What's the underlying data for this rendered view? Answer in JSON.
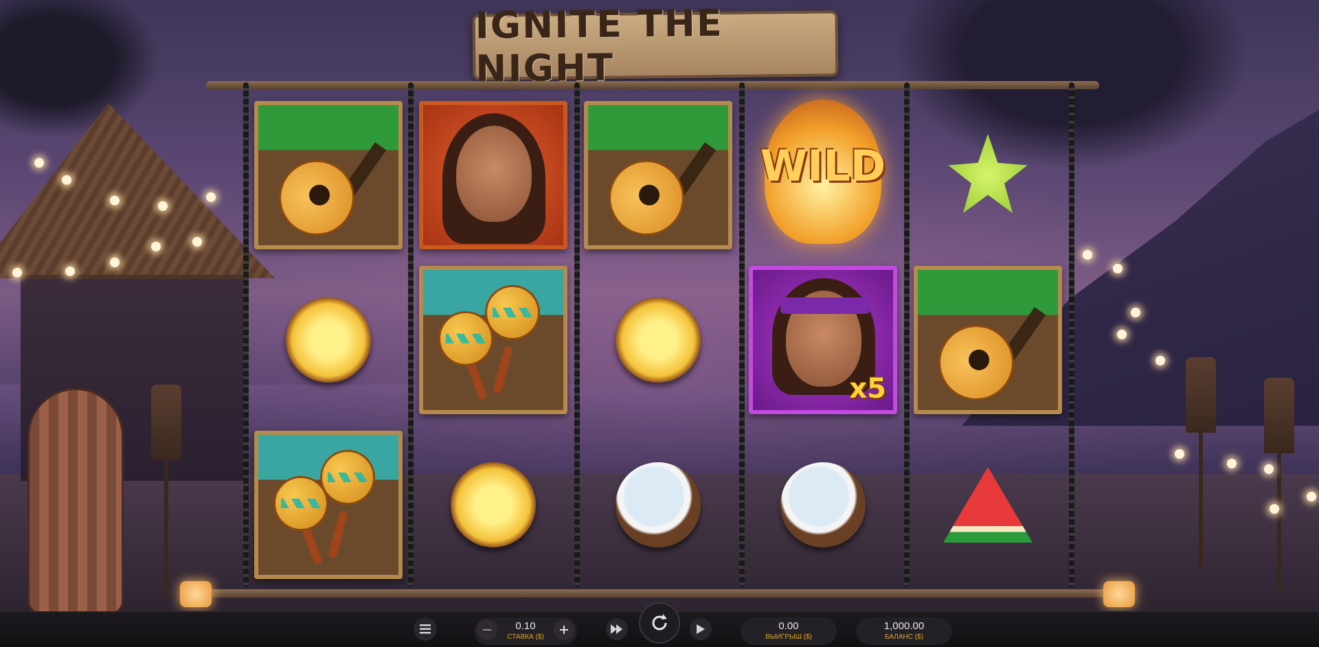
{
  "game": {
    "title": "IGNITE THE NIGHT"
  },
  "reels": [
    [
      "guitar",
      "pineapple",
      "maracas"
    ],
    [
      "woman",
      "maracas",
      "pineapple"
    ],
    [
      "guitar",
      "pineapple",
      "coconut"
    ],
    [
      "wild",
      "man",
      "coconut"
    ],
    [
      "starfruit",
      "guitar",
      "watermelon"
    ]
  ],
  "symbols": {
    "wild_label": "WILD",
    "man_multiplier": "x5"
  },
  "controls": {
    "bet": {
      "value": "0.10",
      "label": "СТАВКА ($)"
    },
    "win": {
      "value": "0.00",
      "label": "ВЫИГРЫШ ($)"
    },
    "balance": {
      "value": "1,000.00",
      "label": "БАЛАНС ($)"
    },
    "menu_icon": "hamburger-icon",
    "minus_icon": "minus-icon",
    "plus_icon": "plus-icon",
    "turbo_icon": "fast-forward-icon",
    "spin_icon": "refresh-icon",
    "autoplay_icon": "play-icon"
  },
  "colors": {
    "accent": "#d9a52a",
    "bar_bg": "#1c1a1e"
  }
}
